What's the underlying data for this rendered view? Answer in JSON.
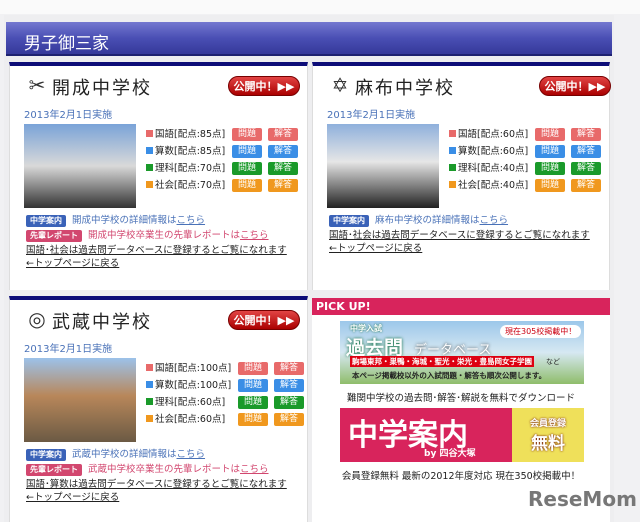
{
  "section_title": "男子御三家",
  "open_label": "公開中！▶▶",
  "schools": [
    {
      "name": "開成中学校",
      "logo": "✂",
      "date": "2013年2月1日実施",
      "subjects": [
        {
          "label": "国語[配点:85点]",
          "color": "#e86a6a"
        },
        {
          "label": "算数[配点:85点]",
          "color": "#3a8ee6"
        },
        {
          "label": "理科[配点:70点]",
          "color": "#1a9a2a"
        },
        {
          "label": "社会[配点:70点]",
          "color": "#f0981e"
        }
      ],
      "info_tag": "中学案内",
      "info_text": "開成中学校の詳細情報は",
      "link": "こちら",
      "report_tag": "先輩レポート",
      "report_text": "開成中学校卒業生の先輩レポートは",
      "note": "国語･社会は過去問データベースに登録するとご覧になれます",
      "back": "←トップページに戻る"
    },
    {
      "name": "麻布中学校",
      "logo": "✡",
      "date": "2013年2月1日実施",
      "subjects": [
        {
          "label": "国語[配点:60点]",
          "color": "#e86a6a"
        },
        {
          "label": "算数[配点:60点]",
          "color": "#3a8ee6"
        },
        {
          "label": "理科[配点:40点]",
          "color": "#1a9a2a"
        },
        {
          "label": "社会[配点:40点]",
          "color": "#f0981e"
        }
      ],
      "info_tag": "中学案内",
      "info_text": "麻布中学校の詳細情報は",
      "link": "こちら",
      "note": "国語･社会は過去問データベースに登録するとご覧になれます",
      "back": "←トップページに戻る"
    },
    {
      "name": "武蔵中学校",
      "logo": "◎",
      "date": "2013年2月1日実施",
      "subjects": [
        {
          "label": "国語[配点:100点]",
          "color": "#e86a6a"
        },
        {
          "label": "算数[配点:100点]",
          "color": "#3a8ee6"
        },
        {
          "label": "理科[配点:60点]",
          "color": "#1a9a2a"
        },
        {
          "label": "社会[配点:60点]",
          "color": "#f0981e"
        }
      ],
      "info_tag": "中学案内",
      "info_text": "武蔵中学校の詳細情報は",
      "link": "こちら",
      "report_tag": "先輩レポート",
      "report_text": "武蔵中学校卒業生の先輩レポートは",
      "note": "国語･算数は過去問データベースに登録するとご覧になれます",
      "back": "←トップページに戻る"
    }
  ],
  "btn_question": "問題",
  "btn_answer": "解答",
  "pickup": {
    "title": "PICK UP!",
    "banner1": {
      "top": "中学入試",
      "main": "過去問",
      "sub": "データベース",
      "badge": "現在305校掲載中！",
      "schools": "駒場東邦・巣鴨・海城・聖光・栄光・豊島岡女子学園",
      "nado": "など",
      "note": "本ページ掲載校以外の入試問題・解答も順次公開します。"
    },
    "caption1": "難関中学校の過去問･解答･解説を無料でダウンロード",
    "banner2": {
      "main": "中学案内",
      "by": "by 四谷大塚",
      "badge1": "会員登録",
      "badge2": "無料"
    },
    "caption2": "会員登録無料 最新の2012年度対応 現在350校掲載中！"
  },
  "watermark": "ReseMom"
}
